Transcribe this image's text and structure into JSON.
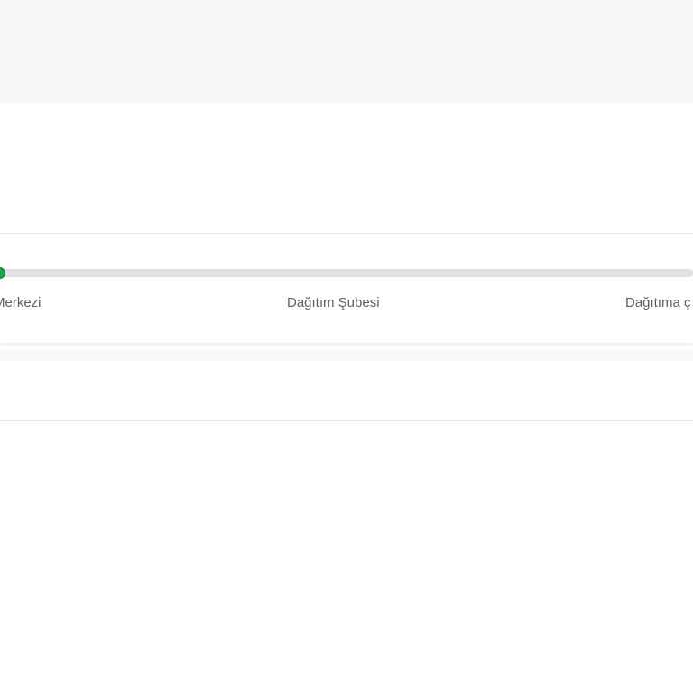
{
  "tracker": {
    "progress_percent": 0,
    "steps": [
      {
        "label": "Merkezi"
      },
      {
        "label": "Dağıtım Şubesi"
      },
      {
        "label": "Dağıtıma ç"
      }
    ]
  },
  "colors": {
    "accent": "#18a84a",
    "track": "#e1e1e1",
    "text": "#5e5e5e"
  }
}
